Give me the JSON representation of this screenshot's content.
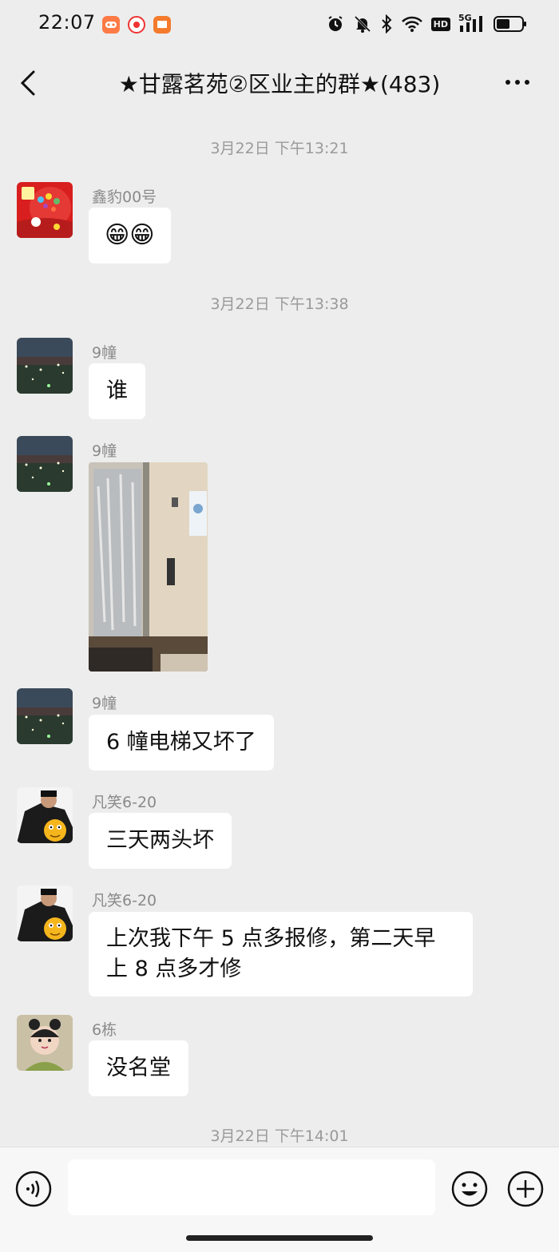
{
  "status_bar": {
    "time": "22:07",
    "network": "5G",
    "hd": "HD"
  },
  "header": {
    "back_icon": "chevron-left-icon",
    "title": "★甘露茗苑②区业主的群★(483)",
    "more_icon": "ellipsis-icon"
  },
  "timestamps": [
    "3月22日 下午13:21",
    "3月22日 下午13:38",
    "3月22日 下午14:01"
  ],
  "messages": [
    {
      "sender": "鑫豹00号",
      "text": "😁😁"
    },
    {
      "sender": "9幢",
      "text": "谁"
    },
    {
      "sender": "9幢",
      "type": "image"
    },
    {
      "sender": "9幢",
      "text": "6 幢电梯又坏了"
    },
    {
      "sender": "凡笑6-20",
      "text": "三天两头坏"
    },
    {
      "sender": "凡笑6-20",
      "text": "上次我下午 5 点多报修，第二天早上 8 点多才修"
    },
    {
      "sender": "6栋",
      "text": "没名堂"
    }
  ],
  "input": {
    "placeholder": "",
    "value": ""
  },
  "icons": {
    "voice": "voice-icon",
    "emoji": "emoji-icon",
    "plus": "plus-icon"
  }
}
